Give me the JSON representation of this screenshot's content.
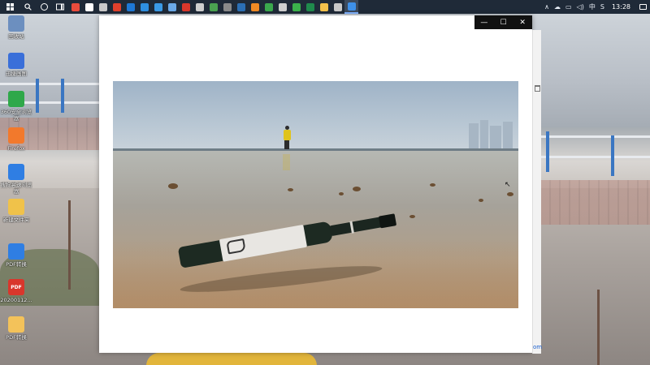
{
  "taskbar": {
    "start_icon": "windows-logo-icon",
    "pinned_apps": [
      {
        "name": "recorder-app-icon",
        "color": "#e94b3c"
      },
      {
        "name": "file-icon",
        "color": "#ffffff"
      },
      {
        "name": "scissors-app-icon",
        "color": "#c9c9c9"
      },
      {
        "name": "red-app-icon",
        "color": "#e0402c"
      },
      {
        "name": "blue-browser-icon",
        "color": "#1e78d6"
      },
      {
        "name": "edge-icon",
        "color": "#2e8fe0"
      },
      {
        "name": "photo-app-icon",
        "color": "#3a9ae6"
      },
      {
        "name": "screenshot-app-icon",
        "color": "#6aa9e8"
      },
      {
        "name": "red-circle-app-icon",
        "color": "#d9372b"
      },
      {
        "name": "qq-browser-icon",
        "color": "#cfcfcf"
      },
      {
        "name": "chrome-icon",
        "color": "#4aa250"
      },
      {
        "name": "settings-app-icon",
        "color": "#8a8a8a"
      },
      {
        "name": "terminal-app-icon",
        "color": "#2b6fb5"
      },
      {
        "name": "orange-app-icon",
        "color": "#f08a24"
      },
      {
        "name": "green-app-icon",
        "color": "#3aa84d"
      },
      {
        "name": "sync-app-icon",
        "color": "#cfcfcf"
      },
      {
        "name": "wechat-icon",
        "color": "#3bb24b"
      },
      {
        "name": "excel-icon",
        "color": "#1f8a4c"
      },
      {
        "name": "folder-icon",
        "color": "#f3c14b"
      },
      {
        "name": "image-app-icon",
        "color": "#c8c8c8"
      },
      {
        "name": "photos-app-icon",
        "color": "#3e90e8"
      }
    ],
    "tray": {
      "chevron": "∧",
      "ime": "中",
      "clock": "13:28",
      "notification_icon": "notification-icon"
    }
  },
  "desktop": {
    "icons": [
      {
        "label": "回收站",
        "icon": "recycle-bin-icon",
        "color": "#6c8fbf"
      },
      {
        "label": "迅捷画图",
        "icon": "xunjie-app-icon",
        "color": "#3a6fd9"
      },
      {
        "label": "360安全浏览器",
        "icon": "360-browser-icon",
        "color": "#2fa84a"
      },
      {
        "label": "Firefox",
        "icon": "firefox-icon",
        "color": "#f2792c"
      },
      {
        "label": "搜狗高速浏览器",
        "icon": "sogou-browser-icon",
        "color": "#2f7ee3"
      },
      {
        "label": "新建文件夹",
        "icon": "folder-icon",
        "color": "#f0c24a"
      },
      {
        "label": "PDF转换",
        "icon": "pdf-convert-icon",
        "color": "#2f7ee3"
      },
      {
        "label": "20200112...",
        "icon": "pdf-file-icon",
        "color": "#d9362c"
      },
      {
        "label": "PDF转换",
        "icon": "pdf-folder-icon",
        "color": "#f3c25a"
      }
    ],
    "pdf_badge": "PDF"
  },
  "viewer": {
    "controls": {
      "minimize": "—",
      "maximize": "☐",
      "close": "✕"
    },
    "side_link_text": "om",
    "photo_alt": "wine bottle lying on wet sandy beach"
  }
}
